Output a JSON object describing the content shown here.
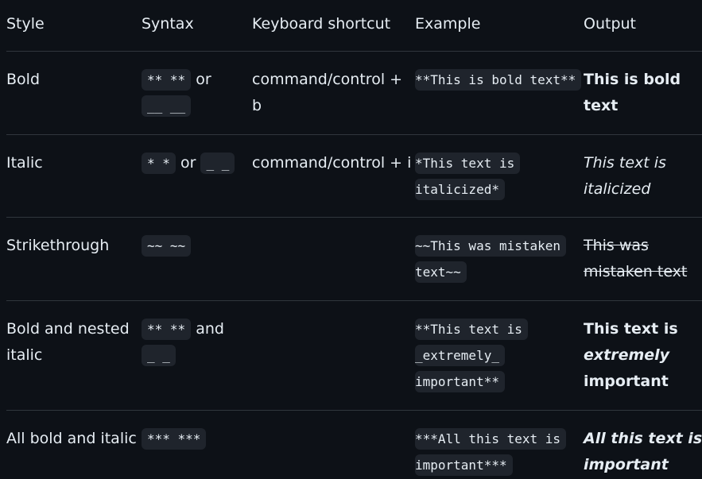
{
  "headers": [
    "Style",
    "Syntax",
    "Keyboard shortcut",
    "Example",
    "Output"
  ],
  "rows": [
    {
      "style": "Bold",
      "syntax_a": "** **",
      "syntax_join": "or",
      "syntax_b": "__ __",
      "shortcut": "command/control + b",
      "example": "**This is bold text**",
      "output": "This is bold text"
    },
    {
      "style": "Italic",
      "syntax_a": "* *",
      "syntax_join": "or",
      "syntax_b": "_ _",
      "shortcut": "command/control + i",
      "example": "*This text is italicized*",
      "output": "This text is italicized"
    },
    {
      "style": "Strikethrough",
      "syntax_a": "~~ ~~",
      "syntax_join": "",
      "syntax_b": "",
      "shortcut": "",
      "example": "~~This was mistaken text~~",
      "output": "This was mistaken text"
    },
    {
      "style": "Bold and nested italic",
      "syntax_a": "** **",
      "syntax_join": "and",
      "syntax_b": "_ _",
      "shortcut": "",
      "example": "**This text is _extremely_ important**",
      "output_pre": "This text is",
      "output_em": "extremely",
      "output_post": "important"
    },
    {
      "style": "All bold and italic",
      "syntax_a": "*** ***",
      "syntax_join": "",
      "syntax_b": "",
      "shortcut": "",
      "example": "***All this text is important***",
      "output": "All this text is important"
    }
  ]
}
